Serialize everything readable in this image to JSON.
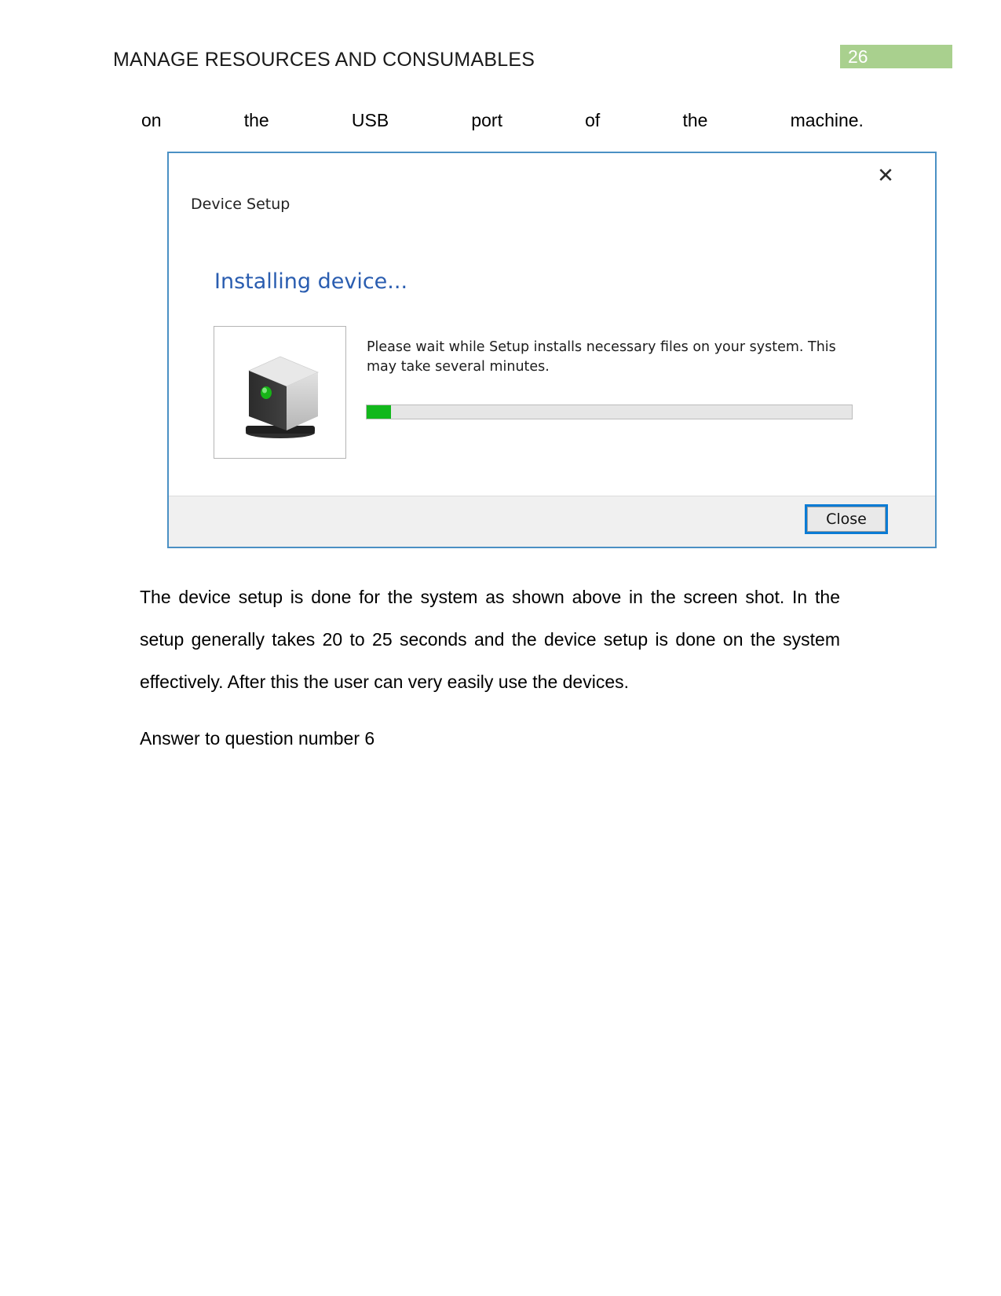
{
  "header": {
    "title": "MANAGE RESOURCES AND CONSUMABLES",
    "page_number": "26",
    "badge_color": "#a9d08e"
  },
  "justified_line": {
    "words": [
      "on",
      "the",
      "USB",
      "port",
      "of",
      "the",
      "machine."
    ]
  },
  "dialog": {
    "title": "Device Setup",
    "heading": "Installing device...",
    "body_text": "Please wait while Setup installs necessary files on your system. This may take several minutes.",
    "close_icon": "close-x-icon",
    "device_icon": "device-tower-icon",
    "progress": {
      "percent": 5,
      "fill_color": "#12b81c",
      "track_color": "#e6e6e6"
    },
    "footer": {
      "close_label": "Close"
    },
    "border_color": "#4a90c4",
    "heading_color": "#2a5db0"
  },
  "paragraphs": {
    "p1": "The device setup is done for the system as shown above in the screen shot. In the setup generally takes 20 to 25 seconds and the device setup is done on the system effectively. After this the user can very easily use the devices.",
    "p2": "Answer to question number 6"
  }
}
